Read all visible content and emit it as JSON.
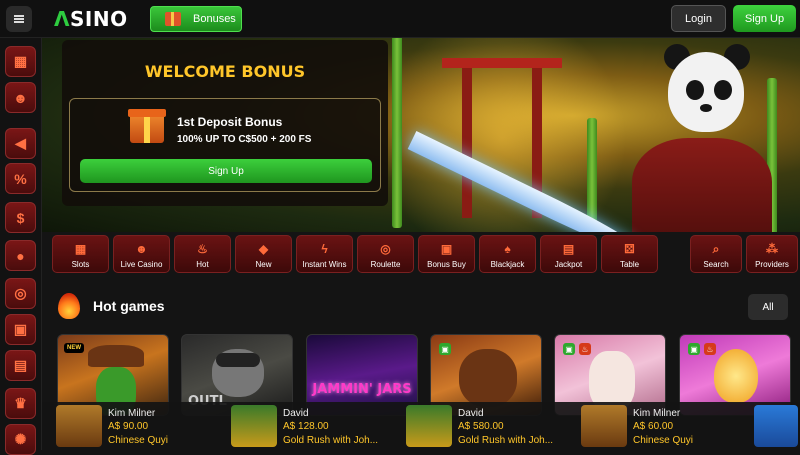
{
  "header": {
    "logo_mark": "Ʌ",
    "logo_text": "SINO",
    "bonuses_label": "Bonuses",
    "login_label": "Login",
    "signup_label": "Sign Up"
  },
  "sidebar": {
    "items": [
      {
        "icon": "grid-icon"
      },
      {
        "icon": "dealer-icon"
      },
      {
        "icon": "megaphone-icon"
      },
      {
        "icon": "percent-icon"
      },
      {
        "icon": "coin-icon"
      },
      {
        "icon": "medal-icon"
      },
      {
        "icon": "target-icon"
      },
      {
        "icon": "map-icon"
      },
      {
        "icon": "shop-icon"
      },
      {
        "icon": "trophy-icon"
      },
      {
        "icon": "wheel-icon"
      }
    ]
  },
  "welcome": {
    "title": "WELCOME BONUS",
    "deposit_title": "1st Deposit Bonus",
    "deposit_sub": "100% UP TO C$500 + 200 FS",
    "signup_label": "Sign Up"
  },
  "categories": [
    {
      "label": "Slots",
      "icon": "grid-icon"
    },
    {
      "label": "Live Casino",
      "icon": "dealer-icon"
    },
    {
      "label": "Hot",
      "icon": "flame-icon"
    },
    {
      "label": "New",
      "icon": "diamond-icon"
    },
    {
      "label": "Instant Wins",
      "icon": "lightning-icon"
    },
    {
      "label": "Roulette",
      "icon": "roulette-icon"
    },
    {
      "label": "Bonus Buy",
      "icon": "gift-icon"
    },
    {
      "label": "Blackjack",
      "icon": "cards-icon"
    },
    {
      "label": "Jackpot",
      "icon": "jackpot-icon"
    },
    {
      "label": "Table",
      "icon": "dice-icon"
    },
    {
      "label": "Search",
      "icon": "search-icon"
    },
    {
      "label": "Providers",
      "icon": "providers-icon"
    }
  ],
  "hot_games": {
    "title": "Hot games",
    "all_label": "All",
    "badges": {
      "new": "NEW"
    },
    "games": [
      {
        "title": ""
      },
      {
        "title": "OUTL"
      },
      {
        "title": "JAMMIN' JARS"
      },
      {
        "title": ""
      },
      {
        "title": ""
      },
      {
        "title": ""
      }
    ]
  },
  "ticker": [
    {
      "name": "Kim Milner",
      "amount": "A$ 90.00",
      "game": "Chinese Quyi"
    },
    {
      "name": "David",
      "amount": "A$ 128.00",
      "game": "Gold Rush with Joh..."
    },
    {
      "name": "David",
      "amount": "A$ 580.00",
      "game": "Gold Rush with Joh..."
    },
    {
      "name": "Kim Milner",
      "amount": "A$ 60.00",
      "game": "Chinese Quyi"
    }
  ]
}
